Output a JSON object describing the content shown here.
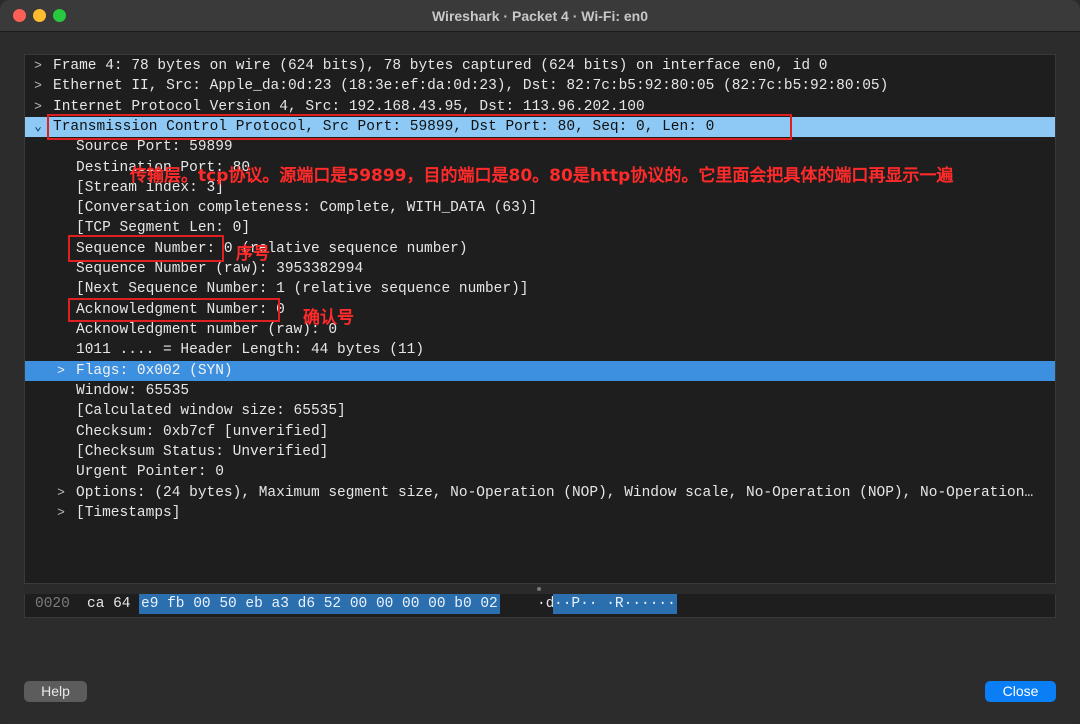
{
  "window": {
    "title": "Wireshark · Packet 4 · Wi-Fi: en0"
  },
  "tree": {
    "rows": [
      {
        "arrow": ">",
        "text": "Frame 4: 78 bytes on wire (624 bits), 78 bytes captured (624 bits) on interface en0, id 0"
      },
      {
        "arrow": ">",
        "text": "Ethernet II, Src: Apple_da:0d:23 (18:3e:ef:da:0d:23), Dst: 82:7c:b5:92:80:05 (82:7c:b5:92:80:05)"
      },
      {
        "arrow": ">",
        "text": "Internet Protocol Version 4, Src: 192.168.43.95, Dst: 113.96.202.100"
      },
      {
        "arrow": "⌄",
        "text": "Transmission Control Protocol, Src Port: 59899, Dst Port: 80, Seq: 0, Len: 0"
      },
      {
        "arrow": "",
        "text": "Source Port: 59899"
      },
      {
        "arrow": "",
        "text": "Destination Port: 80"
      },
      {
        "arrow": "",
        "text": "[Stream index: 3]"
      },
      {
        "arrow": "",
        "text": "[Conversation completeness: Complete, WITH_DATA (63)]"
      },
      {
        "arrow": "",
        "text": "[TCP Segment Len: 0]"
      },
      {
        "arrow": "",
        "text": "Sequence Number: 0    (relative sequence number)"
      },
      {
        "arrow": "",
        "text": "Sequence Number (raw): 3953382994"
      },
      {
        "arrow": "",
        "text": "[Next Sequence Number: 1    (relative sequence number)]"
      },
      {
        "arrow": "",
        "text": "Acknowledgment Number: 0"
      },
      {
        "arrow": "",
        "text": "Acknowledgment number (raw): 0"
      },
      {
        "arrow": "",
        "text": "1011 .... = Header Length: 44 bytes (11)"
      },
      {
        "arrow": ">",
        "text": "Flags: 0x002 (SYN)"
      },
      {
        "arrow": "",
        "text": "Window: 65535"
      },
      {
        "arrow": "",
        "text": "[Calculated window size: 65535]"
      },
      {
        "arrow": "",
        "text": "Checksum: 0xb7cf [unverified]"
      },
      {
        "arrow": "",
        "text": "[Checksum Status: Unverified]"
      },
      {
        "arrow": "",
        "text": "Urgent Pointer: 0"
      },
      {
        "arrow": ">",
        "text": "Options: (24 bytes), Maximum segment size, No-Operation (NOP), Window scale, No-Operation (NOP), No-Operation…"
      },
      {
        "arrow": ">",
        "text": "[Timestamps]"
      }
    ]
  },
  "annotations": {
    "tcp_note": "传输层。tcp协议。源端口是59899，目的端口是80。80是http协议的。它里面会把具体的端口再显示一遍",
    "seq_note": "序号",
    "ack_note": "确认号"
  },
  "hex": {
    "offset": "0020",
    "plain": "ca 64",
    "selected": "e9 fb 00 50 eb a3  d6 52 00 00 00 00 b0 02",
    "ascii_plain": "·d",
    "ascii_selected": "··P·· ·R······"
  },
  "buttons": {
    "help": "Help",
    "close": "Close"
  },
  "colors": {
    "selection": "#8ec9f5",
    "highlight": "#3d8fe0",
    "annotation": "#ff2a2a",
    "primary_button": "#0a7ef5"
  }
}
